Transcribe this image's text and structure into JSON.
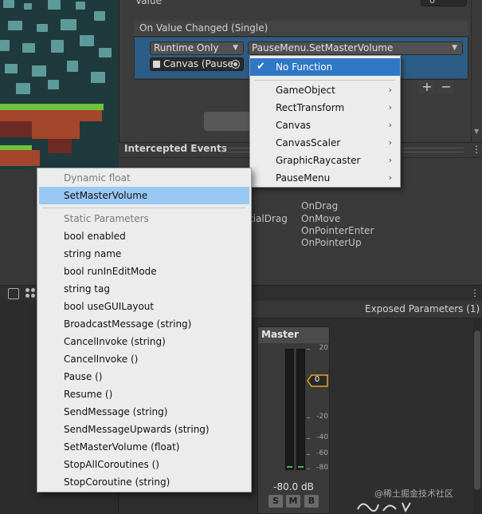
{
  "inspector": {
    "value_label": "Value",
    "value_field": "0",
    "event_header": "On Value Changed (Single)",
    "runtime_dropdown": "Runtime Only",
    "function_dropdown": "PauseMenu.SetMasterVolume",
    "target_object": "Canvas (Pause",
    "plus_label": "+",
    "minus_label": "−"
  },
  "function_menu": {
    "items": [
      {
        "label": "No Function",
        "selected": true,
        "has_submenu": false
      },
      {
        "label": "GameObject",
        "selected": false,
        "has_submenu": true
      },
      {
        "label": "RectTransform",
        "selected": false,
        "has_submenu": true
      },
      {
        "label": "Canvas",
        "selected": false,
        "has_submenu": true
      },
      {
        "label": "CanvasScaler",
        "selected": false,
        "has_submenu": true
      },
      {
        "label": "GraphicRaycaster",
        "selected": false,
        "has_submenu": true
      },
      {
        "label": "PauseMenu",
        "selected": false,
        "has_submenu": true
      }
    ]
  },
  "submenu": {
    "dynamic_header": "Dynamic float",
    "dynamic_items": [
      "SetMasterVolume"
    ],
    "static_header": "Static Parameters",
    "static_items": [
      "bool enabled",
      "string name",
      "bool runInEditMode",
      "string tag",
      "bool useGUILayout",
      "BroadcastMessage (string)",
      "CancelInvoke (string)",
      "CancelInvoke ()",
      "Pause ()",
      "Resume ()",
      "SendMessage (string)",
      "SendMessageUpwards (string)",
      "SetMasterVolume (float)",
      "StopAllCoroutines ()",
      "StopCoroutine (string)"
    ]
  },
  "intercepted": {
    "title": "Intercepted Events",
    "events_left": [
      "tialDrag"
    ],
    "events_right": [
      "OnDrag",
      "OnMove",
      "OnPointerEnter",
      "OnPointerUp"
    ]
  },
  "mixer": {
    "exposed_parameters": "Exposed Parameters (1)",
    "group_name": "Master",
    "db_ticks": [
      "20",
      "-20",
      "-40",
      "-60",
      "-80"
    ],
    "fader_value": "0",
    "volume_readout": "-80.0 dB",
    "solo": "S",
    "mute": "M",
    "bypass": "B"
  },
  "watermark": "@稀土掘金技术社区",
  "colors": {
    "selection_blue": "#2f78c6",
    "highlight_blue": "#99c8f2",
    "event_entry_blue": "#2c5d87",
    "fader_orange": "#e0a81e",
    "meter_green": "#4fb04b"
  }
}
